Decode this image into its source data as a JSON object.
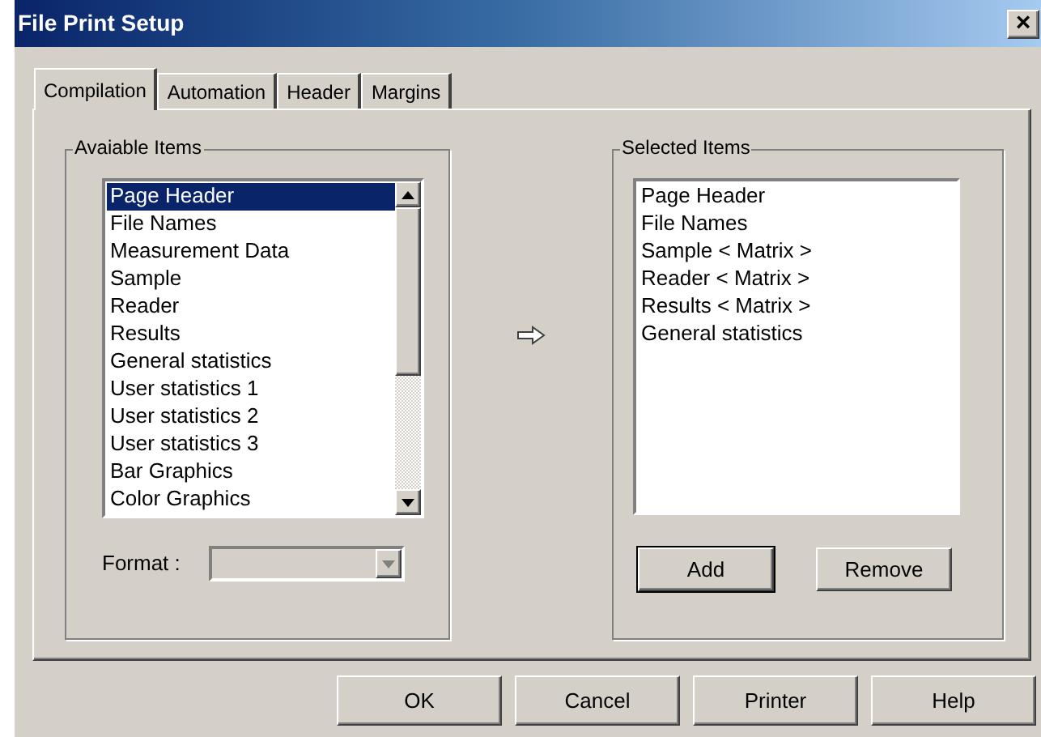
{
  "window": {
    "title": "File Print Setup",
    "close": "×"
  },
  "tabs": [
    {
      "label": "Compilation",
      "selected": true
    },
    {
      "label": "Automation",
      "selected": false
    },
    {
      "label": "Header",
      "selected": false
    },
    {
      "label": "Margins",
      "selected": false
    }
  ],
  "available": {
    "title": "Avaiable Items",
    "items": [
      {
        "label": "Page Header",
        "selected": true
      },
      {
        "label": "File Names",
        "selected": false
      },
      {
        "label": "Measurement Data",
        "selected": false
      },
      {
        "label": "Sample",
        "selected": false
      },
      {
        "label": "Reader",
        "selected": false
      },
      {
        "label": "Results",
        "selected": false
      },
      {
        "label": "General statistics",
        "selected": false
      },
      {
        "label": "User statistics 1",
        "selected": false
      },
      {
        "label": "User statistics 2",
        "selected": false
      },
      {
        "label": "User statistics 3",
        "selected": false
      },
      {
        "label": "Bar Graphics",
        "selected": false
      },
      {
        "label": "Color Graphics",
        "selected": false
      }
    ],
    "format_label": "Format :",
    "format_disabled": true
  },
  "selected": {
    "title": "Selected Items",
    "items": [
      "Page Header",
      "File Names",
      "Sample < Matrix >",
      "Reader < Matrix >",
      "Results < Matrix >",
      "General statistics"
    ],
    "buttons": [
      {
        "label": "Add",
        "default": true
      },
      {
        "label": "Remove",
        "default": false
      }
    ]
  },
  "buttons": [
    "OK",
    "Cancel",
    "Printer",
    "Help"
  ]
}
